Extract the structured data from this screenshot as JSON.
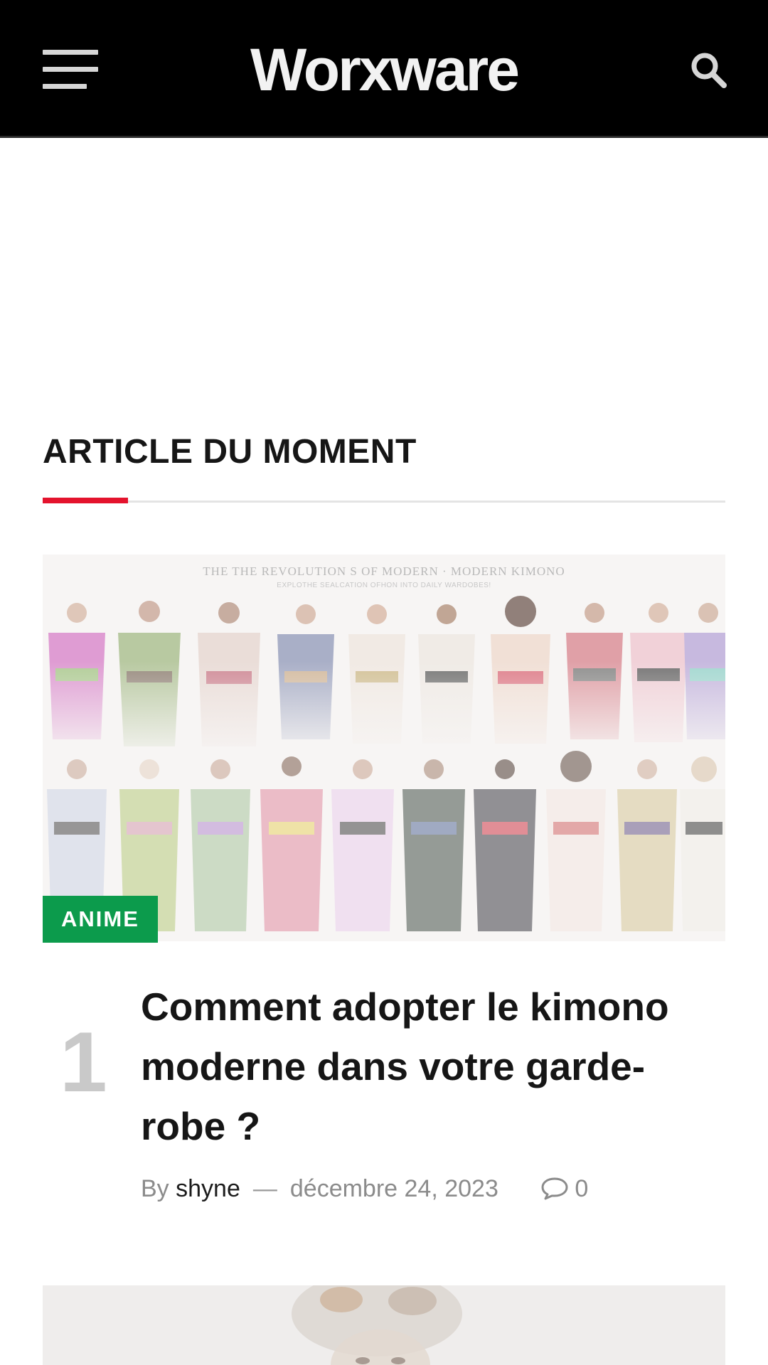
{
  "header": {
    "logo": "Worxware",
    "menu_icon": "hamburger-menu-icon",
    "search_icon": "search-icon",
    "background": "#000000"
  },
  "section": {
    "title": "ARTICLE DU MOMENT",
    "accent_color": "#e4132d"
  },
  "featured": {
    "image_caption": "THE THE REVOLUTION S OF MODERN · MODERN KIMONO",
    "image_subcaption": "EXPLOTHE SEALCATION OFHON INTO DAILY WARDOBES!",
    "category": "ANIME",
    "category_color": "#0c9b4c",
    "rank": "1",
    "title": "Comment adopter le kimono moderne dans votre garde-robe ?",
    "meta": {
      "by": "By",
      "author": "shyne",
      "separator": "—",
      "date": "décembre 24, 2023",
      "comments_icon": "comment-bubble-icon",
      "comments": "0"
    }
  }
}
